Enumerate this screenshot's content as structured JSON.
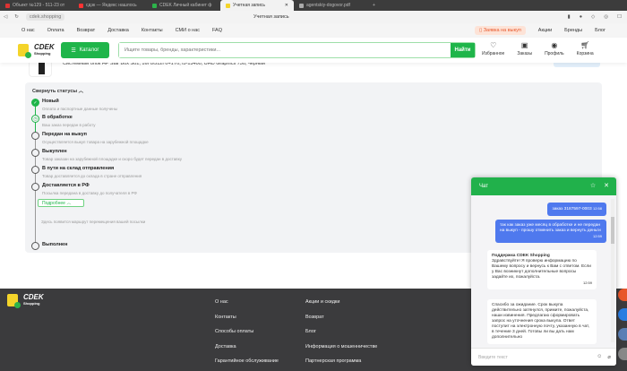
{
  "browser": {
    "tabs": [
      "Объект №129 - 511-23 от",
      "сдэк — Яндекс нашлось",
      "CDEK Личный кабинет ф",
      "Учетная запись",
      "agentskiy-dogovor.pdf"
    ],
    "active_tab": 3,
    "url": "cdek.shopping",
    "page_title": "Учетная запись"
  },
  "topnav": {
    "links": [
      "О нас",
      "Оплата",
      "Возврат",
      "Доставка",
      "Контакты",
      "СМИ о нас",
      "FAQ"
    ],
    "request_button": "Заявка на выкуп",
    "right_links": [
      "Акции",
      "Бренды",
      "Блог"
    ]
  },
  "header": {
    "logo": "CDEK Shopping",
    "catalog": "Каталог",
    "search_placeholder": "Ищите товары, бренды, характеристики...",
    "search_button": "Найти",
    "icons": [
      {
        "icon": "heart-icon",
        "label": "Избранное"
      },
      {
        "icon": "orders-icon",
        "label": "Заказы"
      },
      {
        "icon": "profile-icon",
        "label": "Профиль"
      },
      {
        "icon": "cart-icon",
        "label": "Корзина"
      }
    ]
  },
  "product": {
    "name": "Системный блок HP Star Box S01, 16Гб/512Гб+1Tб, i5-13400, UHD Graphics 730, черный"
  },
  "statuses": {
    "collapse_label": "Свернуть статусы",
    "more_label": "Подробнее",
    "route_text": "Здесь появится маршрут перемещения вашей посылки",
    "items": [
      {
        "title": "Новый",
        "desc": "Оплата и паспортные данные получены",
        "state": "done"
      },
      {
        "title": "В обработке",
        "desc": "Ваш заказ передан в работу",
        "state": "current"
      },
      {
        "title": "Передан на выкуп",
        "desc": "Осуществляется выкуп товара на зарубежной площадке",
        "state": "pending"
      },
      {
        "title": "Выкуплен",
        "desc": "Товар заказан на зарубежной площадке и скоро будет передан в доставку",
        "state": "pending"
      },
      {
        "title": "В пути на склад отправления",
        "desc": "Товар доставляется до склада в стране отправления",
        "state": "pending"
      },
      {
        "title": "Доставляется в РФ",
        "desc": "Посылка передана в доставку до получателя в РФ",
        "state": "pending"
      },
      {
        "title": "Выполнен",
        "desc": "",
        "state": "pending"
      }
    ]
  },
  "footer": {
    "col1": [
      "О нас",
      "Контакты",
      "Способы оплаты",
      "Доставка",
      "Гарантийное обслуживание"
    ],
    "col2": [
      "Акции и скидки",
      "Возврат",
      "Блог",
      "Информация о мошенничестве",
      "Партнерская программа"
    ]
  },
  "chat": {
    "title": "Чат",
    "placeholder": "Введите текст",
    "messages": [
      {
        "text": "заказ 3187597-0003",
        "time": "12:58"
      },
      {
        "text": "так как заказ уже месяц в обработке и не передан на выкуп - прошу отменить заказ и вернуть деньги",
        "time": "12:59"
      },
      {
        "author": "Поддержка CDEK Shopping",
        "text": "Здравствуйте! Я проверю информацию по Вашему вопросу и вернусь к Вам с ответом. Если у Вас возникнут дополнительные вопросы задайте их, пожалуйста.",
        "time": "12:59"
      },
      {
        "text": "Спасибо за ожидание. Срок выкупа действительно затянулся, примите, пожалуйста, наши извинения. Предлагаю сформировать запрос на уточнения срока выкупа. Ответ поступит на электронную почту, указанную в чат, в течение 3 дней. Готовы ли вы дать нам дополнительно"
      }
    ]
  },
  "colors": {
    "green": "#1fb54a",
    "blue": "#4f79ee",
    "footer": "#3b3b3d"
  }
}
